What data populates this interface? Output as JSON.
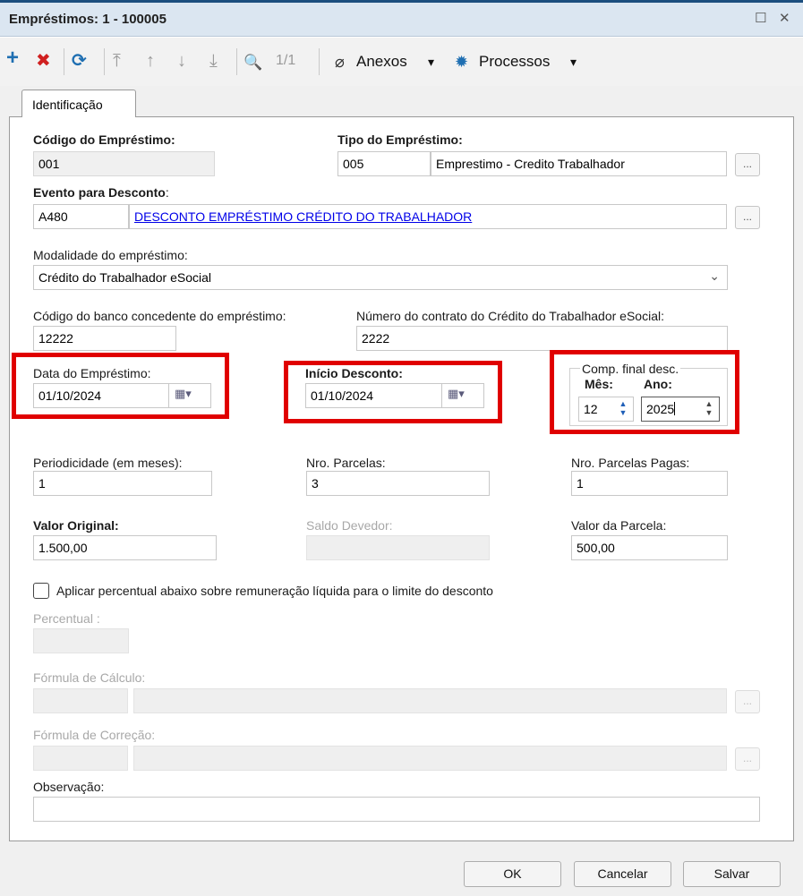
{
  "window": {
    "title": "Empréstimos: 1 - 100005",
    "maximize_glyph": "☐",
    "close_glyph": "✕"
  },
  "toolbar": {
    "add_glyph": "+",
    "delete_glyph": "✖",
    "refresh_glyph": "⟳",
    "first_glyph": "⤒",
    "prev_glyph": "↑",
    "next_glyph": "↓",
    "last_glyph": "⤓",
    "search_glyph": "🔍",
    "page_indicator": "1/1",
    "anexos_label": "Anexos",
    "processos_label": "Processos",
    "caret": "▾"
  },
  "tab": {
    "label": "Identificação"
  },
  "form": {
    "codigo_label": "Código do Empréstimo:",
    "codigo_value": "001",
    "tipo_label": "Tipo do Empréstimo:",
    "tipo_code": "005",
    "tipo_desc": "Emprestimo - Credito Trabalhador",
    "evento_label": "Evento para Desconto",
    "evento_colon": ":",
    "evento_code": "A480",
    "evento_desc": "DESCONTO EMPRÉSTIMO CRÉDITO DO TRABALHADOR",
    "ellipsis": "...",
    "modalidade_label": "Modalidade do empréstimo:",
    "modalidade_value": "Crédito do Trabalhador eSocial",
    "dropdown_arrow": "⌄",
    "banco_label": "Código do banco concedente do empréstimo:",
    "banco_value": "12222",
    "contrato_label": "Número do contrato do Crédito do Trabalhador eSocial:",
    "contrato_value": "2222",
    "data_emprestimo_label": "Data do Empréstimo:",
    "data_emprestimo_value": "01/10/2024",
    "inicio_desconto_label": "Início Desconto:",
    "inicio_desconto_value": "01/10/2024",
    "calendar_glyph": "▦▾",
    "comp_final_label": "Comp. final desc.",
    "mes_label": "Mês:",
    "mes_value": "12",
    "ano_label": "Ano:",
    "ano_value": "2025",
    "spin_glyph": "▲\n▼",
    "periodicidade_label": "Periodicidade (em meses):",
    "periodicidade_value": "1",
    "nro_parcelas_label": "Nro. Parcelas:",
    "nro_parcelas_value": "3",
    "parcelas_pagas_label": "Nro. Parcelas Pagas:",
    "parcelas_pagas_value": "1",
    "valor_original_label": "Valor Original:",
    "valor_original_value": "1.500,00",
    "saldo_devedor_label": "Saldo Devedor:",
    "saldo_devedor_value": "",
    "valor_parcela_label": "Valor da Parcela:",
    "valor_parcela_value": "500,00",
    "aplicar_label": "Aplicar percentual abaixo sobre remuneração líquida para o limite do desconto",
    "percentual_label": "Percentual :",
    "formula_calculo_label": "Fórmula de Cálculo:",
    "formula_correcao_label": "Fórmula de Correção:",
    "observacao_label": "Observação:",
    "observacao_value": ""
  },
  "buttons": {
    "ok": "OK",
    "cancelar": "Cancelar",
    "salvar": "Salvar"
  },
  "colors": {
    "highlight_box": "#e00000",
    "link": "#0000e8",
    "add_icon": "#1f6fb2",
    "delete_icon": "#d02020"
  }
}
